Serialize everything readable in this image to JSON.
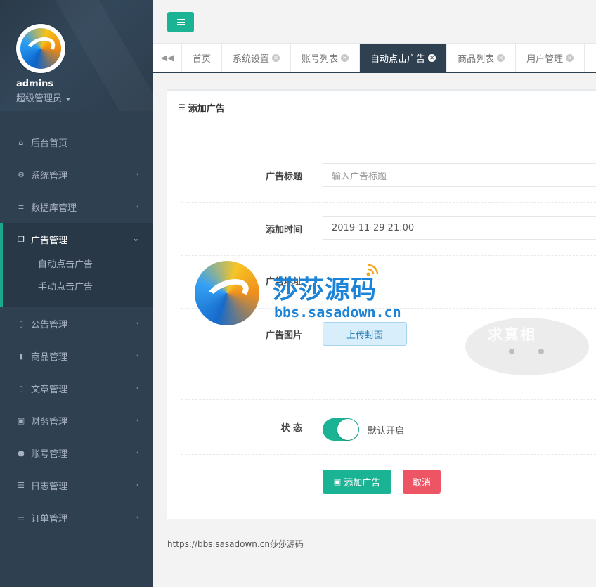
{
  "sidebar": {
    "profile": {
      "name": "admins",
      "role": "超级管理员"
    },
    "items": [
      {
        "label": "后台首页",
        "icon": "home-icon",
        "glyph": "⌂"
      },
      {
        "label": "系统管理",
        "icon": "gear-icon",
        "glyph": "⚙"
      },
      {
        "label": "数据库管理",
        "icon": "database-icon",
        "glyph": "≡"
      },
      {
        "label": "广告管理",
        "icon": "files-icon",
        "glyph": "❐",
        "active": true,
        "children": [
          "自动点击广告",
          "手动点击广告"
        ]
      },
      {
        "label": "公告管理",
        "icon": "file-icon",
        "glyph": "▯"
      },
      {
        "label": "商品管理",
        "icon": "file-filled-icon",
        "glyph": "▮"
      },
      {
        "label": "文章管理",
        "icon": "file-icon",
        "glyph": "▯"
      },
      {
        "label": "财务管理",
        "icon": "money-icon",
        "glyph": "▣"
      },
      {
        "label": "账号管理",
        "icon": "user-icon",
        "glyph": "●"
      },
      {
        "label": "日志管理",
        "icon": "list-icon",
        "glyph": "☰"
      },
      {
        "label": "订单管理",
        "icon": "list-icon",
        "glyph": "☰"
      }
    ]
  },
  "tabs": [
    {
      "label": "首页",
      "closable": false,
      "active": false
    },
    {
      "label": "系统设置",
      "closable": true,
      "active": false
    },
    {
      "label": "账号列表",
      "closable": true,
      "active": false
    },
    {
      "label": "自动点击广告",
      "closable": true,
      "active": true
    },
    {
      "label": "商品列表",
      "closable": true,
      "active": false
    },
    {
      "label": "用户管理",
      "closable": true,
      "active": false
    }
  ],
  "panel": {
    "title": "添加广告"
  },
  "form": {
    "title_label": "广告标题",
    "title_placeholder": "输入广告标题",
    "time_label": "添加时间",
    "time_value": "2019-11-29 21:00",
    "url_label": "广告地址",
    "image_label": "广告图片",
    "upload_label": "上传封面",
    "status_label": "状 态",
    "status_on": true,
    "status_text": "默认开启",
    "submit_label": "添加广告",
    "cancel_label": "取消"
  },
  "watermark": {
    "title": "莎莎源码",
    "url": "bbs.sasadown.cn",
    "stamp": "求真相"
  },
  "footer": {
    "text": "https://bbs.sasadown.cn莎莎源码"
  },
  "colors": {
    "accent": "#1ab394",
    "sidebar": "#2f4050",
    "danger": "#ed5565",
    "upload": "#d9eefb"
  }
}
